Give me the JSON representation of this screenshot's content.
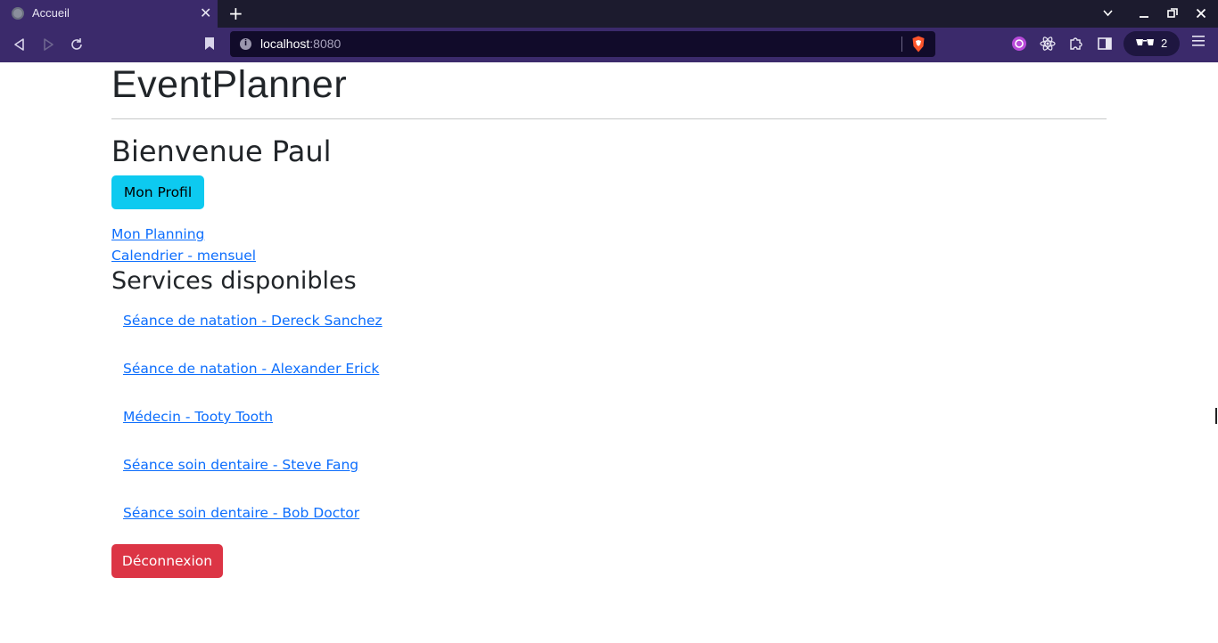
{
  "browser": {
    "tab_title": "Accueil",
    "tab_close": "✕",
    "new_tab": "+",
    "url_host": "localhost",
    "url_port": ":8080",
    "wallet_count": "2",
    "window_controls": {
      "minimize": "–",
      "maximize": "⧉",
      "close": "✕"
    },
    "icons": [
      "globe-icon",
      "back-icon",
      "forward-icon",
      "reload-icon",
      "bookmark-icon",
      "info-icon",
      "brave-shield-icon",
      "extension-purple-icon",
      "react-devtools-icon",
      "puzzle-icon",
      "sidebar-icon",
      "wallet-icon",
      "hamburger-menu-icon"
    ]
  },
  "page": {
    "app_title": "EventPlanner",
    "welcome": "Bienvenue Paul",
    "profile_button": "Mon Profil",
    "links": {
      "planning": "Mon Planning",
      "calendar": "Calendrier - mensuel"
    },
    "services_title": "Services disponibles",
    "services": [
      "Séance de natation - Dereck Sanchez",
      "Séance de natation - Alexander Erick",
      "Médecin - Tooty Tooth",
      "Séance soin dentaire - Steve Fang",
      "Séance soin dentaire - Bob Doctor"
    ],
    "logout_button": "Déconnexion"
  },
  "colors": {
    "chrome_bg": "#3b2a6b",
    "tabbar_bg": "#1c1b2e",
    "link": "#0d6efd",
    "btn_info": "#0dcaf0",
    "btn_danger": "#dc3545"
  }
}
